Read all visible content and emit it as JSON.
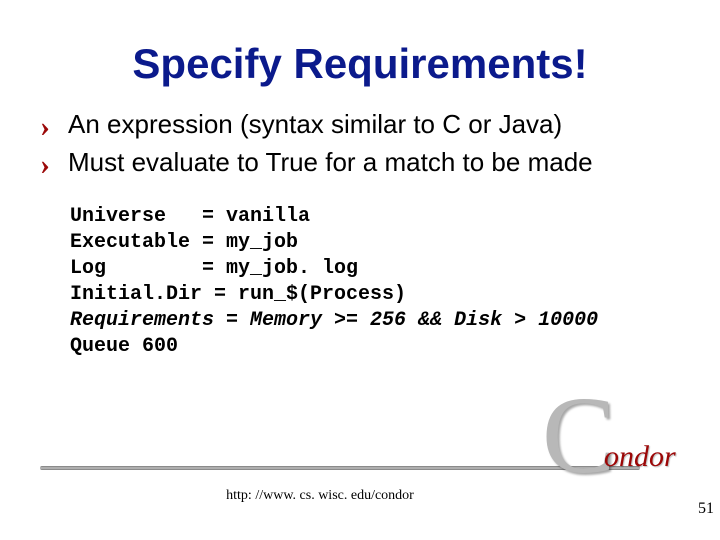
{
  "title": "Specify Requirements!",
  "bullets": [
    "An expression (syntax similar to C or Java)",
    "Must evaluate to True for a match to be made"
  ],
  "code": {
    "universe": "Universe   = vanilla",
    "executable": "Executable = my_job",
    "log": "Log        = my_job. log",
    "initialdir": "Initial.Dir = run_$(Process)",
    "requirements": "Requirements = Memory >= 256 && Disk > 10000",
    "queue": "Queue 600"
  },
  "footer_url": "http: //www. cs. wisc. edu/condor",
  "page_number": "51",
  "logo": {
    "c": "C",
    "rest": "ondor"
  }
}
